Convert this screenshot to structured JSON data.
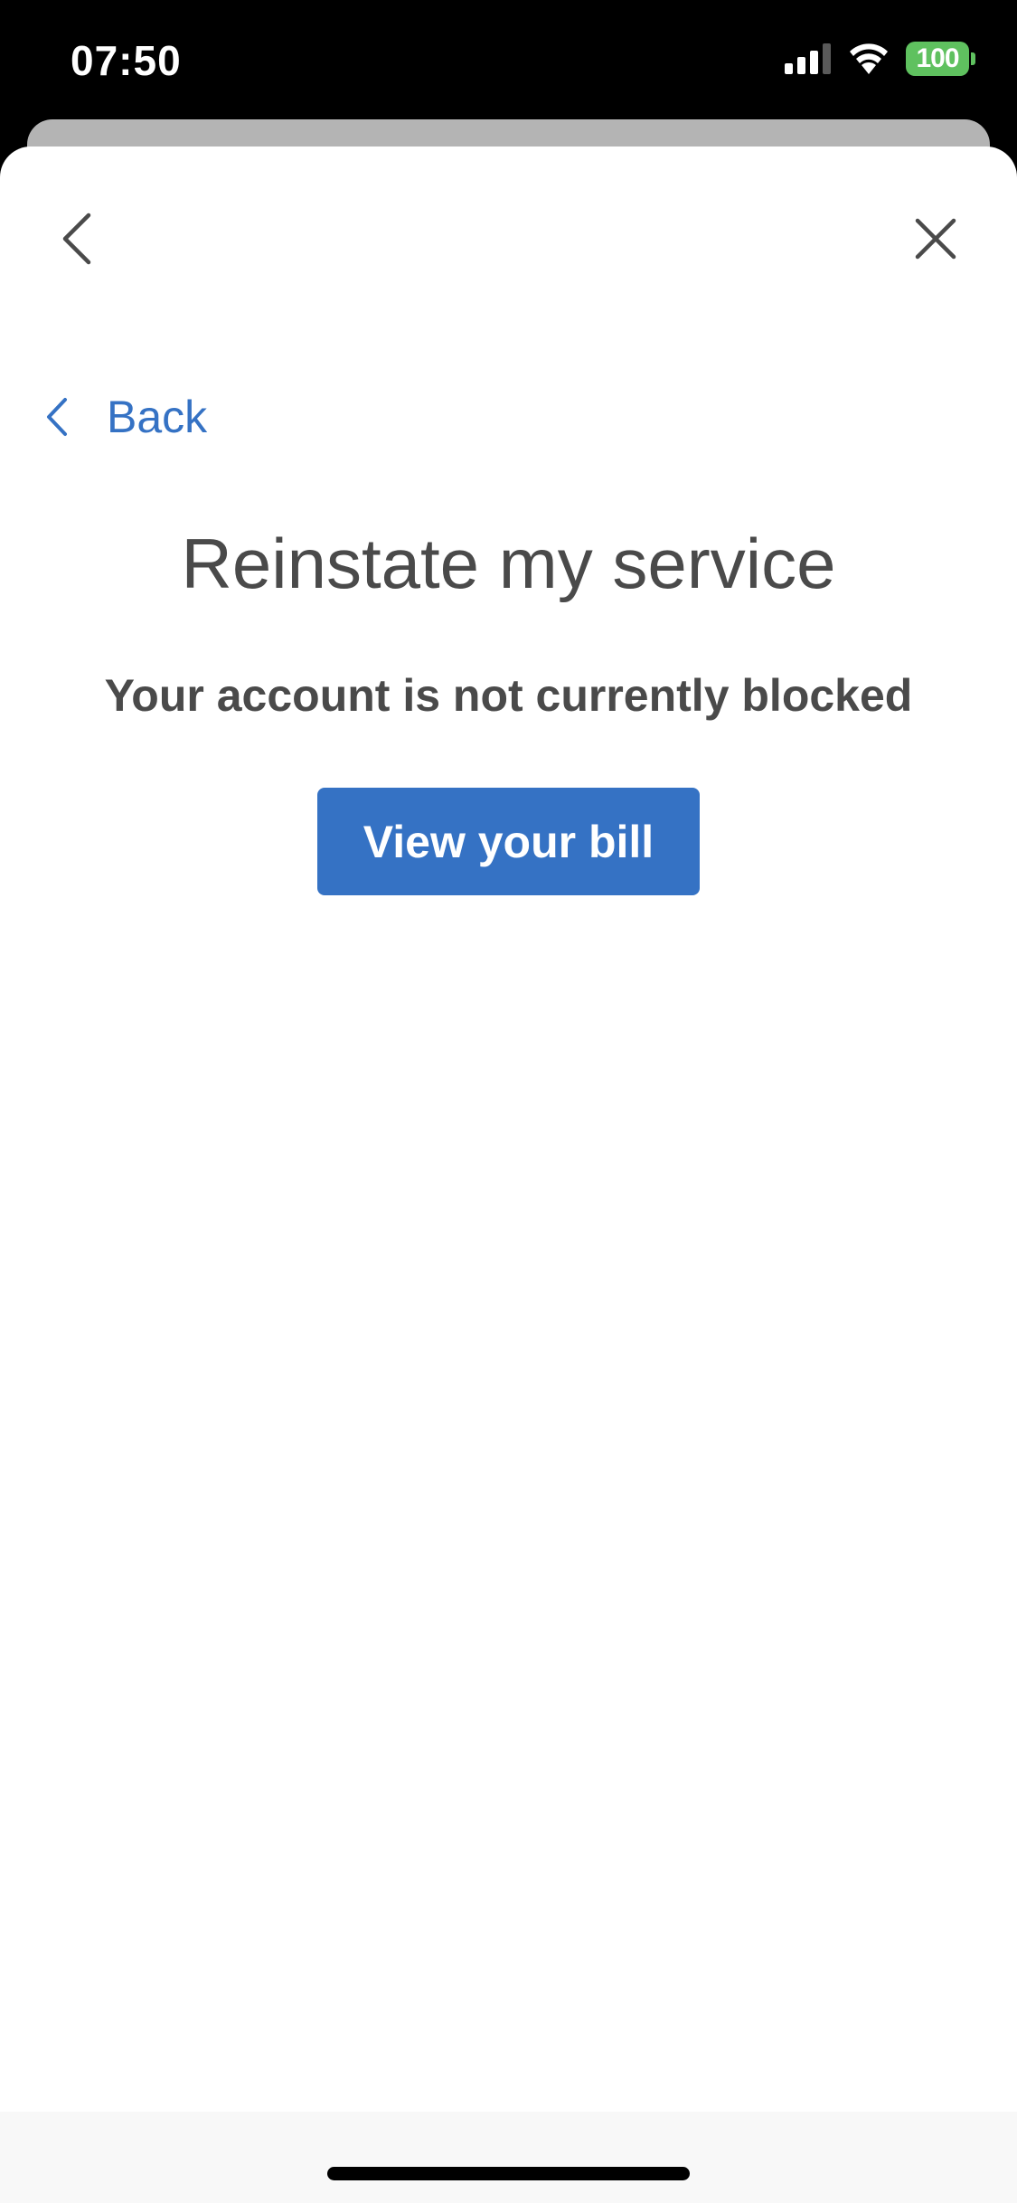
{
  "status_bar": {
    "time": "07:50",
    "battery_level": "100",
    "icons": [
      "signal-icon",
      "wifi-icon",
      "battery-icon"
    ],
    "battery_color": "#5fc15f"
  },
  "nav": {
    "back_icon": "chevron-left-icon",
    "close_icon": "close-icon"
  },
  "back_link": {
    "label": "Back",
    "icon": "chevron-left-icon"
  },
  "page": {
    "title": "Reinstate my service",
    "message": "Your account is not currently blocked",
    "button_label": "View your bill"
  },
  "colors": {
    "accent": "#3572c4",
    "text": "#4a4a4a",
    "background": "#ffffff"
  }
}
